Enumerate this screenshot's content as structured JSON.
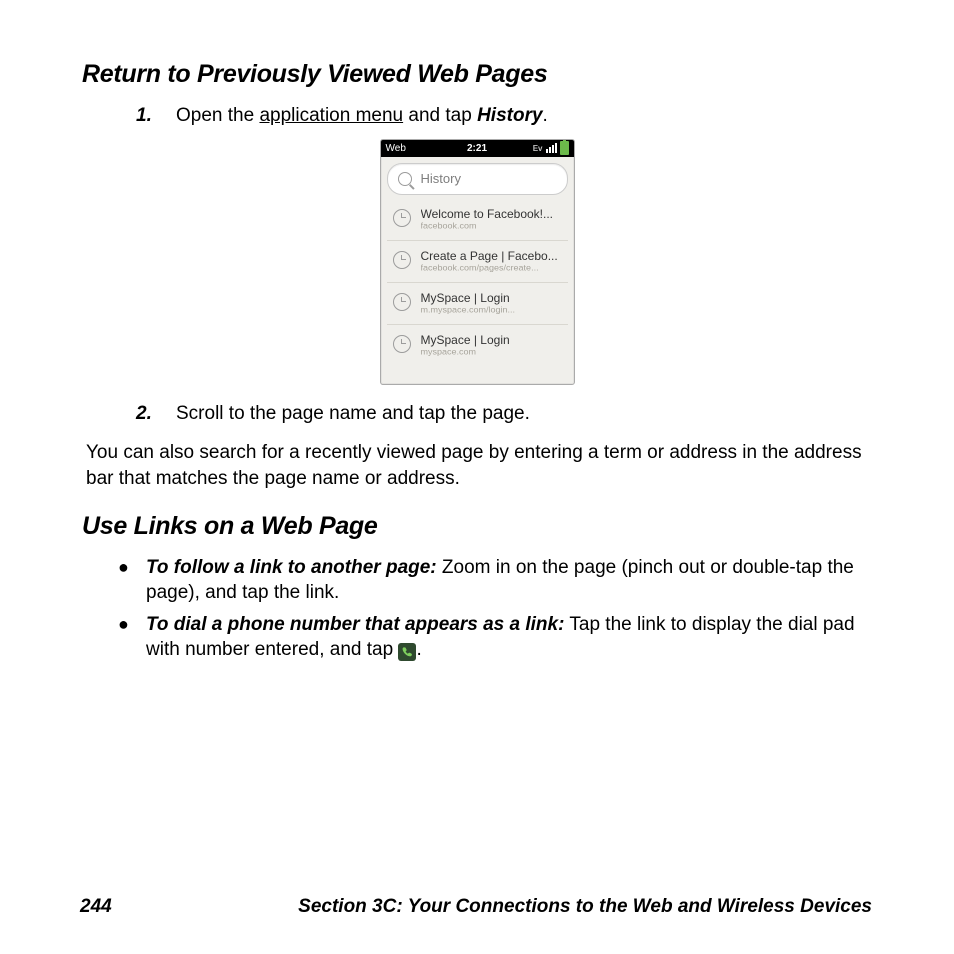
{
  "heading1": "Return to Previously Viewed Web Pages",
  "step1": {
    "num": "1.",
    "pre": "Open the ",
    "link": "application menu",
    "mid": " and tap ",
    "em": "History",
    "post": "."
  },
  "phone": {
    "app": "Web",
    "time": "2:21",
    "indicator": "Ev",
    "search_placeholder": "History",
    "items": [
      {
        "title": "Welcome to Facebook!...",
        "url": "facebook.com"
      },
      {
        "title": "Create a Page | Facebo...",
        "url": "facebook.com/pages/create..."
      },
      {
        "title": "MySpace | Login",
        "url": "m.myspace.com/login..."
      },
      {
        "title": "MySpace | Login",
        "url": "myspace.com"
      }
    ]
  },
  "step2": {
    "num": "2.",
    "text": "Scroll to the page name and tap the page."
  },
  "para1": "You can also search for a recently viewed page by entering a term or address in the address bar that matches the page name or address.",
  "heading2": "Use Links on a Web Page",
  "bullet1": {
    "lead": "To follow a link to another page:",
    "rest": " Zoom in on the page (pinch out or double-tap the page), and tap the link."
  },
  "bullet2": {
    "lead": "To dial a phone number that appears as a link:",
    "rest_a": " Tap the link to display the dial pad with number entered, and tap ",
    "rest_b": "."
  },
  "footer": {
    "page": "244",
    "section": "Section 3C: Your Connections to the Web and Wireless Devices"
  }
}
